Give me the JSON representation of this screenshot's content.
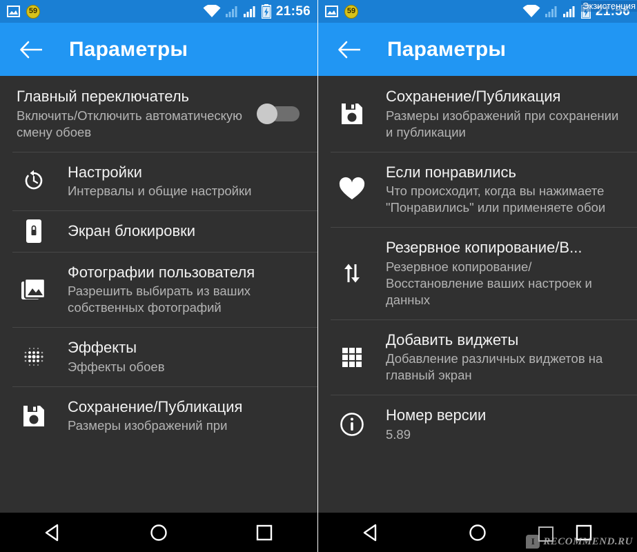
{
  "statusbar": {
    "image_icon": "image-icon",
    "badge_count": "59",
    "wifi_icon": "wifi-icon",
    "signal_icon_1": "signal-bars-dim-icon",
    "signal_icon_2": "signal-bars-icon",
    "battery_icon": "battery-charging-icon",
    "clock": "21:56"
  },
  "appbar": {
    "back_icon": "back-arrow-icon",
    "title": "Параметры"
  },
  "colors": {
    "accent_blue": "#2196f3",
    "statusbar_blue": "#1a7fd4",
    "background": "#303030",
    "divider": "#474747",
    "title_text": "#f2f2f2",
    "subtitle_text": "#b4b4b4",
    "toggle_track": "#6e6e6e",
    "toggle_thumb": "#c9c9c9"
  },
  "left_screen": {
    "items": [
      {
        "icon": "none",
        "title": "Главный переключатель",
        "subtitle": "Включить/Отключить автоматическую смену обоев",
        "trailing": "toggle-switch",
        "toggle_state": "off"
      },
      {
        "icon": "timer-icon",
        "title": "Настройки",
        "subtitle": "Интервалы и общие настройки"
      },
      {
        "icon": "lock-screen-icon",
        "title": "Экран блокировки",
        "subtitle": ""
      },
      {
        "icon": "photo-stack-icon",
        "title": "Фотографии пользователя",
        "subtitle": "Разрешить выбирать из ваших собственных фотографий"
      },
      {
        "icon": "dot-grid-effects-icon",
        "title": "Эффекты",
        "subtitle": "Эффекты обоев"
      },
      {
        "icon": "save-floppy-icon",
        "title": "Сохранение/Публикация",
        "subtitle": "Размеры изображений при"
      }
    ]
  },
  "right_screen": {
    "watermark_top": "Экзистенция",
    "items": [
      {
        "icon": "save-floppy-icon",
        "title": "Сохранение/Публикация",
        "subtitle": "Размеры изображений при сохранении и публикации"
      },
      {
        "icon": "heart-icon",
        "title": "Если понравились",
        "subtitle": "Что происходит, когда вы нажимаете \"Понравились\" или применяете обои"
      },
      {
        "icon": "backup-restore-icon",
        "title": "Резервное копирование/В...",
        "subtitle": "Резервное копирование/ Восстановление ваших настроек и данных"
      },
      {
        "icon": "widget-grid-icon",
        "title": "Добавить виджеты",
        "subtitle": "Добавление различных виджетов на главный экран"
      },
      {
        "icon": "info-icon",
        "title": "Номер версии",
        "subtitle": "5.89"
      }
    ]
  },
  "navbar": {
    "back": "nav-back-triangle-icon",
    "home": "nav-home-circle-icon",
    "recents": "nav-recents-square-icon"
  },
  "watermark_bottom": {
    "logo": "recommend-logo-icon",
    "text": "RECOMMEND.RU"
  }
}
